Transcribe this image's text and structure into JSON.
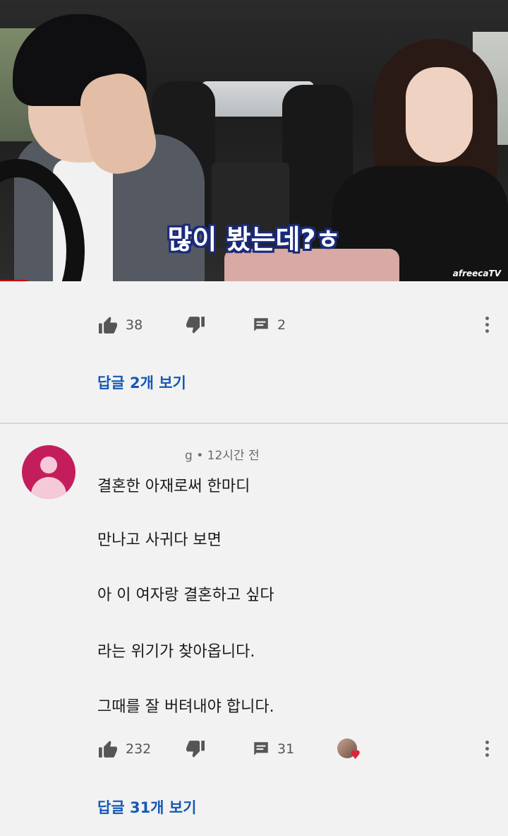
{
  "video": {
    "caption": "많이 봤는데?ㅎ",
    "watermark": "afreecaTV"
  },
  "comment1": {
    "likes": "38",
    "replies_count": "2",
    "view_replies": "답글 2개 보기"
  },
  "comment2": {
    "author_fragment": "g",
    "time": "• 12시간 전",
    "lines": [
      "결혼한 아재로써 한마디",
      "만나고 사귀다 보면",
      "아 이 여자랑 결혼하고 싶다",
      "라는 위기가 찾아옵니다.",
      "그때를 잘 버텨내야 합니다."
    ],
    "likes": "232",
    "replies_count": "31",
    "view_replies": "답글 31개 보기"
  },
  "colors": {
    "link": "#1558b5",
    "avatar": "#c41d5c",
    "background": "#f2f2f2"
  },
  "icons": [
    "thumb-up-icon",
    "thumb-down-icon",
    "reply-icon",
    "more-vertical-icon",
    "heart-icon",
    "avatar-icon"
  ]
}
